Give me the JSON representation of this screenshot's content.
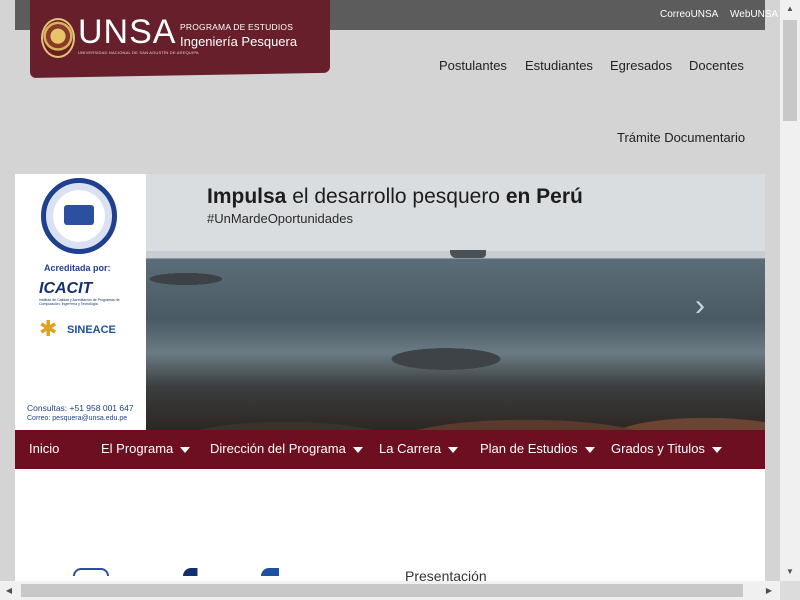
{
  "topbar": {
    "correo": "CorreoUNSA",
    "web": "WebUNSA"
  },
  "logo": {
    "unsa_word": "UNSA",
    "unsa_sub": "UNIVERSIDAD NACIONAL DE SAN AGUSTÍN DE AREQUIPA",
    "program_small": "PROGRAMA DE ESTUDIOS",
    "program_name": "Ingeniería Pesquera"
  },
  "nav": {
    "items": [
      "Postulantes",
      "Estudiantes",
      "Egresados",
      "Docentes"
    ],
    "tramite": "Trámite Documentario"
  },
  "hero": {
    "headline_bold1": "Impulsa",
    "headline_mid": " el desarrollo pesquero ",
    "headline_bold2": "en Perú",
    "hashtag": "#UnMardeOportunidades",
    "accreditation": {
      "label": "Acreditada por:",
      "icacit": "ICACIT",
      "icacit_sub": "Instituto de Calidad y Acreditación de Programas de Computación, Ingeniería y Tecnología",
      "sineace": "SINEACE",
      "contact_phone": "Consultas: +51 958 001 647",
      "contact_email": "Correo: pesquera@unsa.edu.pe"
    }
  },
  "menu": {
    "items": [
      {
        "label": "Inicio"
      },
      {
        "label": "El Programa"
      },
      {
        "label": "Dirección del Programa"
      },
      {
        "label": "La Carrera"
      },
      {
        "label": "Plan de Estudios"
      },
      {
        "label": "Grados y Titulos"
      }
    ]
  },
  "content": {
    "presentacion": "Presentación"
  }
}
